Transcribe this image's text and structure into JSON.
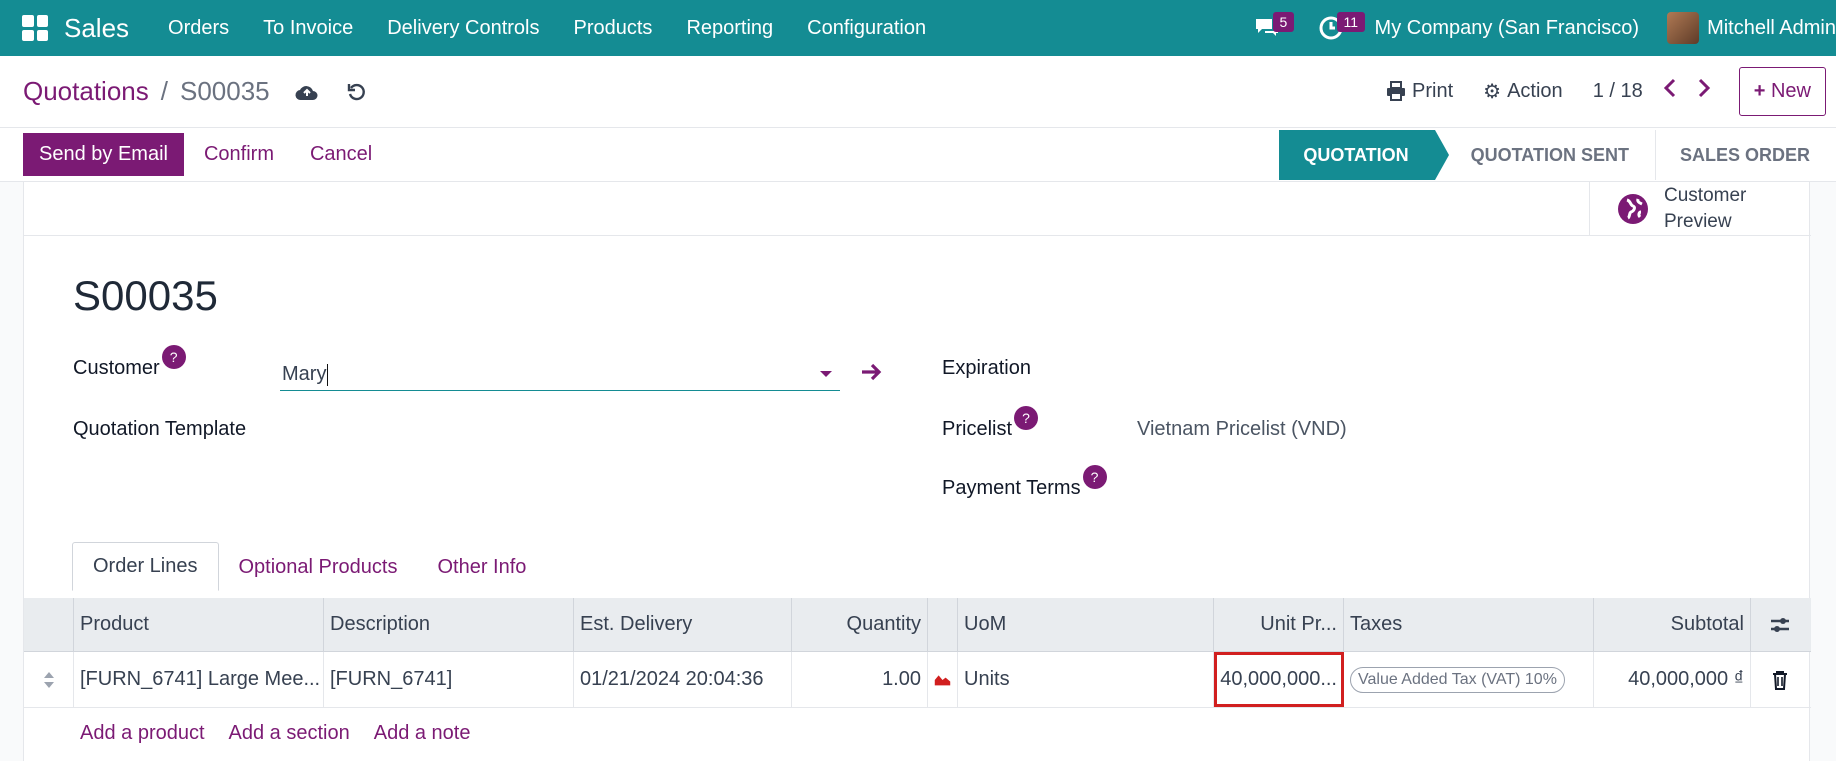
{
  "topbar": {
    "app_name": "Sales",
    "menu": [
      "Orders",
      "To Invoice",
      "Delivery Controls",
      "Products",
      "Reporting",
      "Configuration"
    ],
    "messages_count": "5",
    "activities_count": "11",
    "company": "My Company (San Francisco)",
    "user": "Mitchell Admin"
  },
  "control_panel": {
    "breadcrumb_parent": "Quotations",
    "breadcrumb_sep": "/",
    "breadcrumb_current": "S00035",
    "print_label": "Print",
    "action_label": "Action",
    "pager": "1 / 18",
    "new_label": "New"
  },
  "statusbar": {
    "send_email": "Send by Email",
    "confirm": "Confirm",
    "cancel": "Cancel",
    "stages": [
      "QUOTATION",
      "QUOTATION SENT",
      "SALES ORDER"
    ]
  },
  "form": {
    "preview_line1": "Customer",
    "preview_line2": "Preview",
    "title": "S00035",
    "customer_label": "Customer",
    "customer_value": "Mary",
    "template_label": "Quotation Template",
    "expiration_label": "Expiration",
    "pricelist_label": "Pricelist",
    "pricelist_value": "Vietnam Pricelist (VND)",
    "payment_terms_label": "Payment Terms",
    "help_mark": "?"
  },
  "tabs": [
    "Order Lines",
    "Optional Products",
    "Other Info"
  ],
  "table": {
    "headers": [
      "Product",
      "Description",
      "Est. Delivery",
      "Quantity",
      "UoM",
      "Unit Pr...",
      "Taxes",
      "Subtotal"
    ],
    "rows": [
      {
        "product": "[FURN_6741] Large Mee...",
        "description": "[FURN_6741]",
        "delivery": "01/21/2024 20:04:36",
        "quantity": "1.00",
        "uom": "Units",
        "unit_price": "40,000,000...",
        "tax": "Value Added Tax (VAT) 10%",
        "subtotal": "40,000,000 ₫"
      }
    ],
    "add_product": "Add a product",
    "add_section": "Add a section",
    "add_note": "Add a note"
  },
  "colors": {
    "brand": "#148c93",
    "primary": "#7b1a74",
    "highlight": "#d11f1f"
  }
}
